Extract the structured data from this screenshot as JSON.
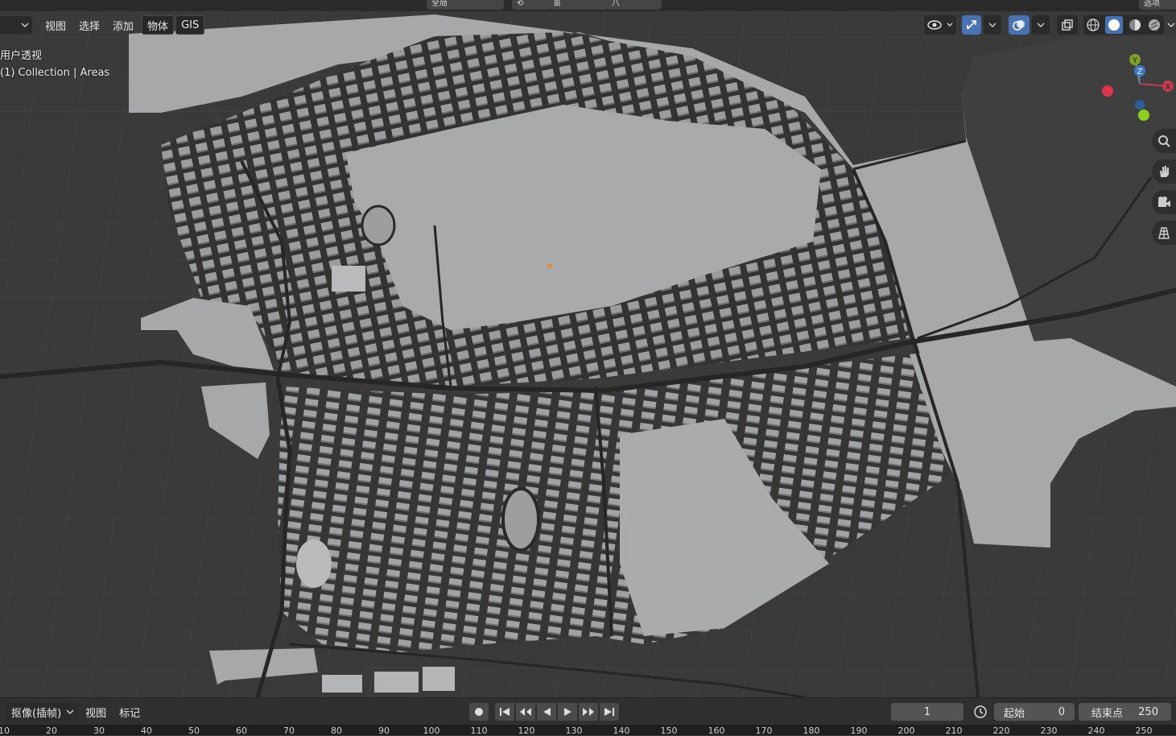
{
  "header": {
    "top_items": [
      "全局",
      "⟲",
      "⊞",
      "八"
    ],
    "top_right": "选项",
    "menu": [
      "视图",
      "选择",
      "添加",
      "物体",
      "GIS"
    ]
  },
  "viewport": {
    "overlay_line1": "用户透视",
    "overlay_line2": "(1) Collection | Areas",
    "gizmo": {
      "x": "X",
      "y": "Y",
      "z": "Z"
    }
  },
  "icons": [
    "visibility-icon",
    "gizmo-toggle-icon",
    "overlay-icon",
    "xray-icon",
    "wireframe-shading-icon",
    "solid-shading-icon",
    "material-shading-icon",
    "rendered-shading-icon",
    "zoom-icon",
    "hand-pan-icon",
    "camera-icon",
    "grid-ortho-icon"
  ],
  "timeline": {
    "mode": "抠像(插帧)",
    "menu": [
      "视图",
      "标记"
    ],
    "current_frame": "1",
    "start_label": "起始",
    "start_value": "0",
    "end_label": "结束点",
    "end_value": "250"
  },
  "ruler": [
    "10",
    "20",
    "30",
    "40",
    "50",
    "60",
    "70",
    "80",
    "90",
    "100",
    "110",
    "120",
    "130",
    "140",
    "150",
    "160",
    "170",
    "180",
    "190",
    "200",
    "210",
    "220",
    "230",
    "240",
    "250"
  ],
  "colors": {
    "ground": "#a3a5a6",
    "building": "#c7c9ca",
    "roads": "#2c2c2c",
    "grid_bg": "#3a3a3a",
    "accent": "#4772b3"
  }
}
